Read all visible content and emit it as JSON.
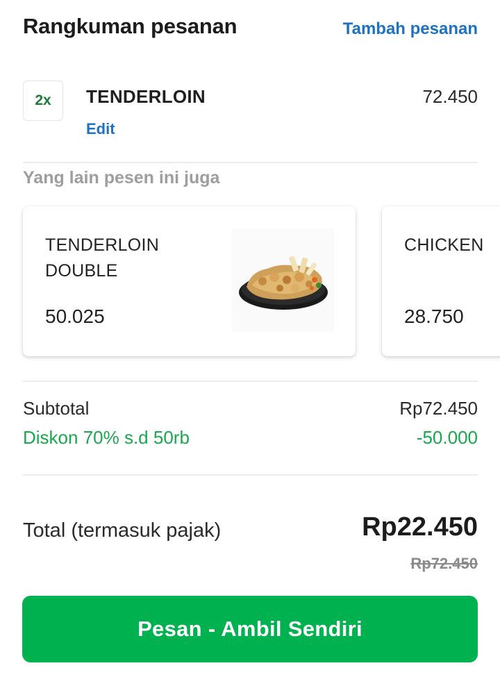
{
  "header": {
    "title": "Rangkuman pesanan",
    "add_order_label": "Tambah pesanan"
  },
  "order": {
    "items": [
      {
        "quantity": "2x",
        "name": "TENDERLOIN",
        "edit_label": "Edit",
        "price": "72.450"
      }
    ]
  },
  "upsell": {
    "heading": "Yang lain pesen ini juga",
    "cards": [
      {
        "name": "TENDERLOIN DOUBLE",
        "price": "50.025",
        "image": "grilled-chicken-sizzling-plate"
      },
      {
        "name": "CHICKEN",
        "price": "28.750"
      }
    ]
  },
  "summary": {
    "subtotal_label": "Subtotal",
    "subtotal_value": "Rp72.450",
    "discount_label": "Diskon 70% s.d 50rb",
    "discount_value": "-50.000",
    "total_label": "Total (termasuk pajak)",
    "total_value": "Rp22.450",
    "original_total": "Rp72.450"
  },
  "action": {
    "button_label": "Pesan - Ambil Sendiri"
  },
  "colors": {
    "accent_green": "#00b14f",
    "discount_green": "#1aa84f",
    "link_blue": "#1d72c4"
  }
}
